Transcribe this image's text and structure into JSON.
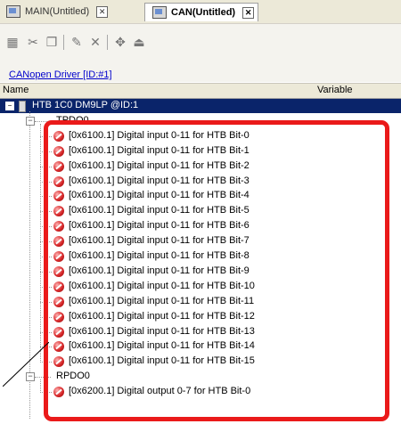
{
  "tabs": [
    {
      "label": "MAIN(Untitled)",
      "active": false,
      "close": "✕"
    },
    {
      "label": "CAN(Untitled)",
      "active": true,
      "close": "✕"
    }
  ],
  "toolbar_icons": [
    "align-icon",
    "cut-icon",
    "copy-icon",
    "paste-icon",
    "delete-icon",
    "add-icon",
    "remove-icon"
  ],
  "driver_link": "CANopen Driver [ID:#1]",
  "columns": {
    "name": "Name",
    "variable": "Variable"
  },
  "device": {
    "label": "HTB 1C0 DM9LP @ID:1",
    "toggle": "−"
  },
  "groups": [
    {
      "label": "TPDO0",
      "toggle": "−",
      "items": [
        "[0x6100.1] Digital input 0-11 for HTB Bit-0",
        "[0x6100.1] Digital input 0-11 for HTB Bit-1",
        "[0x6100.1] Digital input 0-11 for HTB Bit-2",
        "[0x6100.1] Digital input 0-11 for HTB Bit-3",
        "[0x6100.1] Digital input 0-11 for HTB Bit-4",
        "[0x6100.1] Digital input 0-11 for HTB Bit-5",
        "[0x6100.1] Digital input 0-11 for HTB Bit-6",
        "[0x6100.1] Digital input 0-11 for HTB Bit-7",
        "[0x6100.1] Digital input 0-11 for HTB Bit-8",
        "[0x6100.1] Digital input 0-11 for HTB Bit-9",
        "[0x6100.1] Digital input 0-11 for HTB Bit-10",
        "[0x6100.1] Digital input 0-11 for HTB Bit-11",
        "[0x6100.1] Digital input 0-11 for HTB Bit-12",
        "[0x6100.1] Digital input 0-11 for HTB Bit-13",
        "[0x6100.1] Digital input 0-11 for HTB Bit-14",
        "[0x6100.1] Digital input 0-11 for HTB Bit-15"
      ]
    },
    {
      "label": "RPDO0",
      "toggle": "−",
      "items": [
        "[0x6200.1] Digital output 0-7 for HTB Bit-0"
      ]
    }
  ],
  "colors": {
    "highlight": "#ea1a1a",
    "selection": "#0a246a",
    "link": "#0000cc"
  }
}
